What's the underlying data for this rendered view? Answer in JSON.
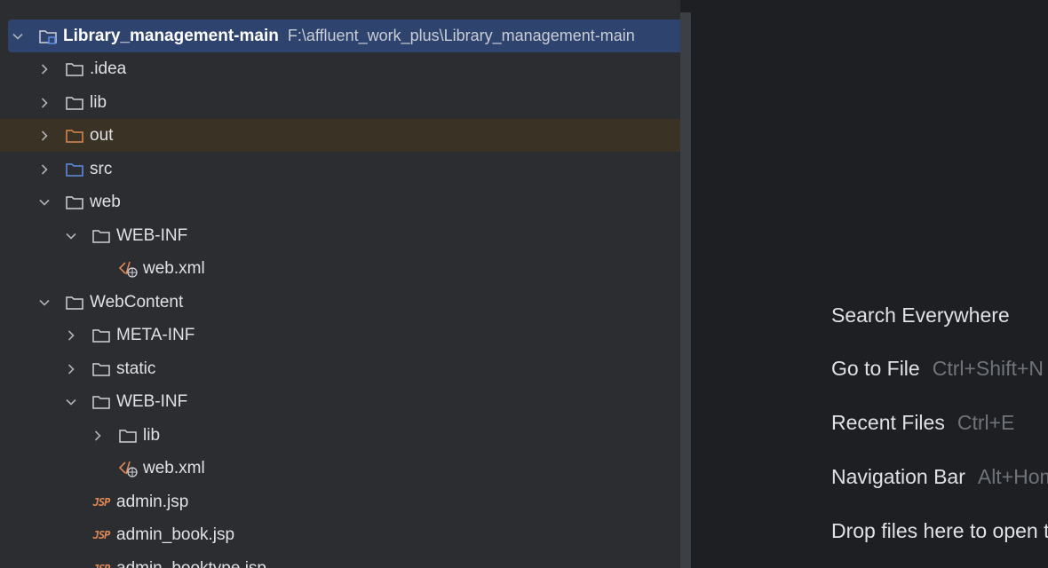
{
  "tree": {
    "root": {
      "label": "Library_management-main",
      "path": "F:\\affluent_work_plus\\Library_management-main"
    },
    "items": [
      {
        "label": ".idea",
        "icon": "folder-icon"
      },
      {
        "label": "lib",
        "icon": "folder-icon"
      },
      {
        "label": "out",
        "icon": "folder-excluded-icon"
      },
      {
        "label": "src",
        "icon": "folder-source-icon"
      },
      {
        "label": "web",
        "icon": "folder-icon"
      },
      {
        "label": "WEB-INF",
        "icon": "folder-icon"
      },
      {
        "label": "web.xml",
        "icon": "xml-file-icon"
      },
      {
        "label": "WebContent",
        "icon": "folder-icon"
      },
      {
        "label": "META-INF",
        "icon": "folder-icon"
      },
      {
        "label": "static",
        "icon": "folder-icon"
      },
      {
        "label": "WEB-INF",
        "icon": "folder-icon"
      },
      {
        "label": "lib",
        "icon": "folder-icon"
      },
      {
        "label": "web.xml",
        "icon": "xml-file-icon"
      },
      {
        "label": "admin.jsp",
        "icon": "jsp-file-icon"
      },
      {
        "label": "admin_book.jsp",
        "icon": "jsp-file-icon"
      },
      {
        "label": "admin_booktype.jsp",
        "icon": "jsp-file-icon"
      }
    ]
  },
  "jsp_badge": "JSP",
  "hints": [
    {
      "label": "Search Everywhere",
      "shortcut": ""
    },
    {
      "label": "Go to File",
      "shortcut": "Ctrl+Shift+N"
    },
    {
      "label": "Recent Files",
      "shortcut": "Ctrl+E"
    },
    {
      "label": "Navigation Bar",
      "shortcut": "Alt+Home"
    },
    {
      "label": "Drop files here to open them",
      "shortcut": ""
    }
  ],
  "colors": {
    "panel_bg": "#2b2d30",
    "editor_bg": "#1e1f22",
    "selection": "#2e436e",
    "excluded_row": "#3b3226",
    "excluded_folder": "#d98a4f",
    "source_folder": "#5c8fe6",
    "jsp": "#e08855"
  }
}
